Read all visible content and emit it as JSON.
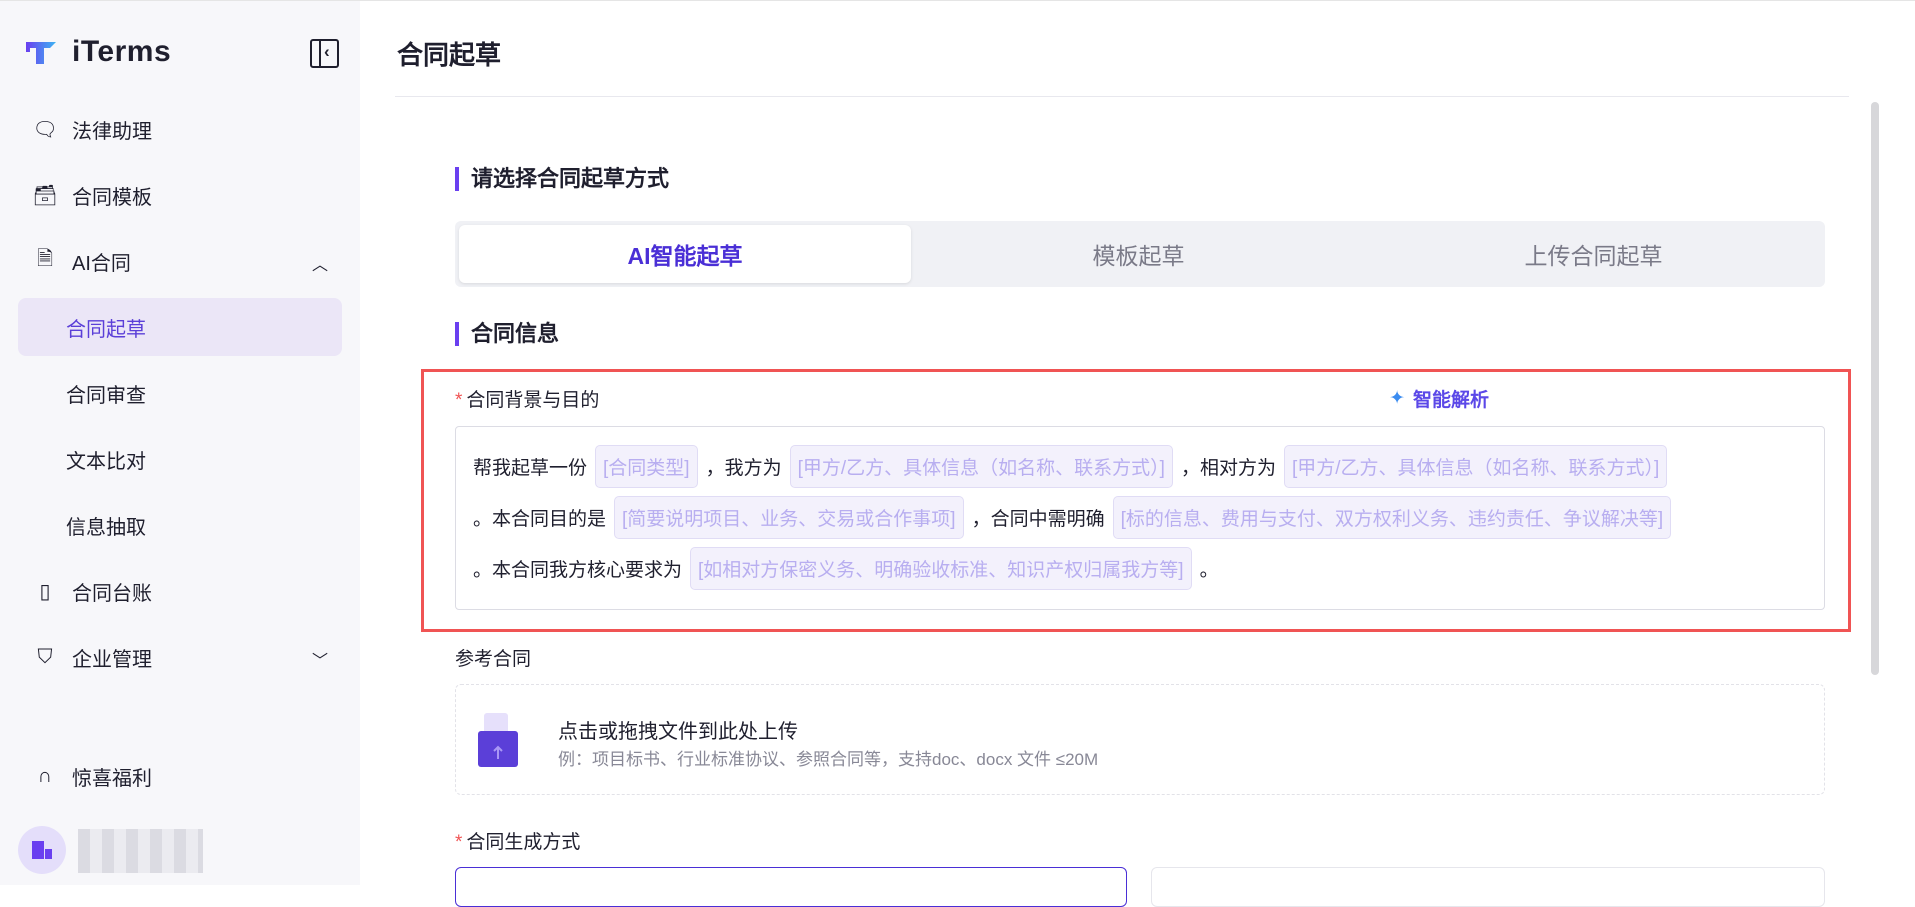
{
  "app": {
    "name": "iTerms"
  },
  "sidebar": {
    "items": [
      {
        "label": "法律助理"
      },
      {
        "label": "合同模板"
      },
      {
        "label": "AI合同"
      },
      {
        "label": "合同起草"
      },
      {
        "label": "合同审查"
      },
      {
        "label": "文本比对"
      },
      {
        "label": "信息抽取"
      },
      {
        "label": "合同台账"
      },
      {
        "label": "企业管理"
      }
    ],
    "bonus": "惊喜福利"
  },
  "page": {
    "title": "合同起草",
    "section1": "请选择合同起草方式",
    "tabs": [
      "AI智能起草",
      "模板起草",
      "上传合同起草"
    ],
    "section2": "合同信息",
    "background_label": "合同背景与目的",
    "smart_parse": "智能解析",
    "prompt": {
      "t1": "帮我起草一份",
      "c1": "[合同类型]",
      "t2": "，我方为",
      "c2": "[甲方/乙方、具体信息（如名称、联系方式）]",
      "t3": "，相对方为",
      "c3": "[甲方/乙方、具体信息（如名称、联系方式）]",
      "t4": "。本合同目的是",
      "c4": "[简要说明项目、业务、交易或合作事项]",
      "t5": "，合同中需明确",
      "c5": "[标的信息、费用与支付、双方权利义务、违约责任、争议解决等]",
      "t6": "。本合同我方核心要求为",
      "c6": "[如相对方保密义务、明确验收标准、知识产权归属我方等]",
      "t7": "。"
    },
    "reference_label": "参考合同",
    "upload_title": "点击或拖拽文件到此处上传",
    "upload_hint": "例：项目标书、行业标准协议、参照合同等，支持doc、docx 文件 ≤20M",
    "gen_label": "合同生成方式",
    "required_mark": "*"
  },
  "colors": {
    "accent": "#5b3fd8",
    "highlight": "#f05454"
  }
}
